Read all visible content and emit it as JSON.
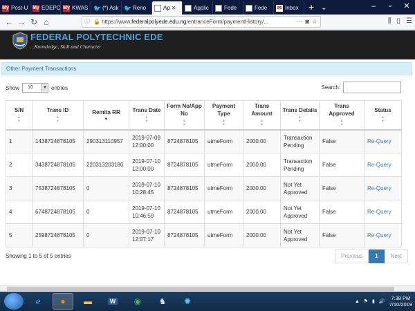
{
  "browser": {
    "tabs": [
      {
        "label": "Post-U",
        "icon": "my-icon"
      },
      {
        "label": "EDEPO",
        "icon": "my-icon"
      },
      {
        "label": "KWAS",
        "icon": "my-icon"
      },
      {
        "label": "(*) Ask",
        "icon": "twitter-icon"
      },
      {
        "label": "Reno",
        "icon": "twitter-icon"
      },
      {
        "label": "Ap",
        "icon": "page-icon",
        "active": true
      },
      {
        "label": "Applic",
        "icon": "page-icon"
      },
      {
        "label": "Fede",
        "icon": "page-icon"
      },
      {
        "label": "Fede",
        "icon": "page-icon"
      },
      {
        "label": "Inbox",
        "icon": "mail-icon"
      }
    ],
    "url_prefix": "https://www.",
    "url_host": "federalpolyede.edu.ng",
    "url_path": "/entranceForm/paymentHistory/..."
  },
  "site": {
    "name": "FEDERAL POLYTECHNIC EDE",
    "tagline": "...Knowledge, Skill and Character"
  },
  "panel": {
    "title": "Other Payment Transactions"
  },
  "controls": {
    "show_label": "Show",
    "page_size": "10",
    "entries_label": "entries",
    "search_label": "Search:"
  },
  "table": {
    "headers": {
      "sn": "S/N",
      "trans_id": "Trans ID",
      "remita": "Remita RR",
      "date": "Trans Date",
      "form": "Form No/App No",
      "type": "Payment Type",
      "amount": "Trans Amount",
      "details": "Trans Details",
      "approved": "Trans Approved",
      "status": "Status"
    },
    "rows": [
      {
        "sn": "1",
        "trans_id": "1438724878105",
        "remita": "290313110957",
        "date": "2019-07-09 12:00:00",
        "form": "8724878105",
        "type": "utmeForm",
        "amount": "2000.00",
        "details": "Transaction Pending",
        "approved": "False",
        "status": "Re-Query"
      },
      {
        "sn": "2",
        "trans_id": "3438724878105",
        "remita": "220313203180",
        "date": "2019-07-10 12:00:00",
        "form": "8724878105",
        "type": "utmeForm",
        "amount": "2000.00",
        "details": "Transaction Pending",
        "approved": "False",
        "status": "Re-Query"
      },
      {
        "sn": "3",
        "trans_id": "7538724878105",
        "remita": "0",
        "date": "2019-07-10 10:28:45",
        "form": "8724878105",
        "type": "utmeForm",
        "amount": "2000.00",
        "details": "Not Yet Approved",
        "approved": "False",
        "status": "Re-Query"
      },
      {
        "sn": "4",
        "trans_id": "6748724878105",
        "remita": "0",
        "date": "2019-07-10 10:46:59",
        "form": "8724878105",
        "type": "utmeForm",
        "amount": "2000.00",
        "details": "Not Yet Approved",
        "approved": "False",
        "status": "Re-Query"
      },
      {
        "sn": "5",
        "trans_id": "2598724878105",
        "remita": "0",
        "date": "2019-07-10 12:07:17",
        "form": "8724878105",
        "type": "utmeForm",
        "amount": "2000.00",
        "details": "Not Yet Approved",
        "approved": "False",
        "status": "Re-Query"
      }
    ]
  },
  "footer": {
    "info": "Showing 1 to 5 of 5 entries",
    "previous": "Previous",
    "current_page": "1",
    "next": "Next"
  },
  "taskbar": {
    "time": "7:38 PM",
    "date": "7/10/2019"
  },
  "colors": {
    "header_bg": "#1f1f1f",
    "brand_blue": "#4fa3e0",
    "link": "#337ab7",
    "panel_bg": "#d9edf7"
  }
}
